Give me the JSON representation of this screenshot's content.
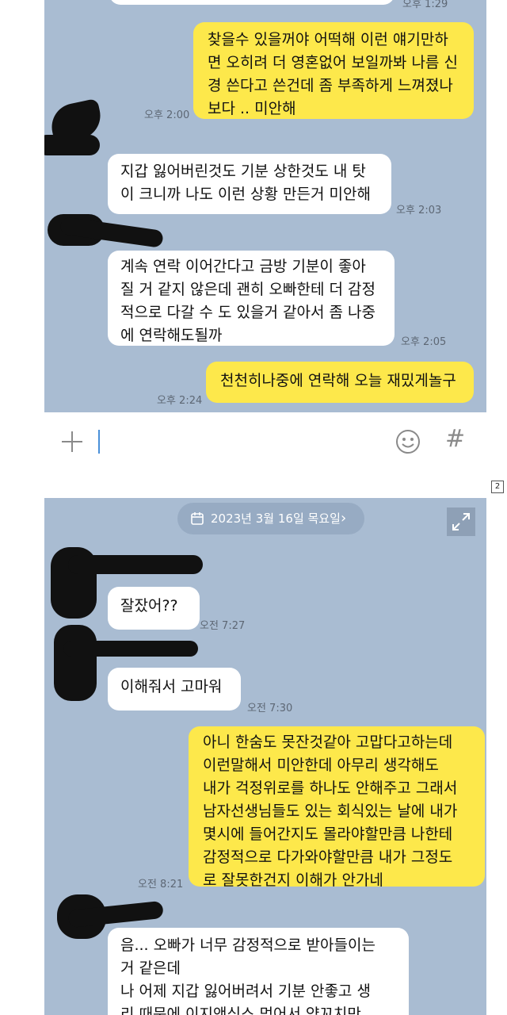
{
  "chat1": {
    "top_time": "오후 1:29",
    "messages": [
      {
        "side": "me",
        "text": "찾을수 있을꺼야 어떡해 이런 얘기만하\n면 오히려 더 영혼없어 보일까봐 나름 신\n경 쓴다고 쓴건데 좀 부족하게 느껴졌나\n보다 .. 미안해",
        "time": "오후 2:00"
      },
      {
        "side": "them",
        "text": "지갑 잃어버린것도 기분 상한것도 내 탓\n이 크니까 나도 이런 상황 만든거 미안해",
        "time": "오후 2:03"
      },
      {
        "side": "them",
        "text": "계속 연락 이어간다고 금방 기분이 좋아\n질 거 같지 않은데 괜히 오빠한테 더 감정\n적으로 다갈 수 도 있을거 같아서 좀 나중\n에 연락해도될까",
        "time": "오후 2:05"
      },
      {
        "side": "me",
        "text": "천천히나중에 연락해 오늘 재밌게놀구",
        "time": "오후 2:24"
      }
    ]
  },
  "input_bar": {
    "plus_icon": "plus-icon",
    "emoji_icon": "emoji-icon",
    "hash_symbol": "#"
  },
  "page_number": "2",
  "chat2": {
    "date_label": "2023년 3월 16일 목요일",
    "date_chevron": "›",
    "messages": [
      {
        "side": "them",
        "text": "잘잤어??",
        "time": "오전 7:27"
      },
      {
        "side": "them",
        "text": "이해줘서 고마워",
        "time": "오전 7:30"
      },
      {
        "side": "me",
        "text": "아니 한숨도 못잔것같아 고맙다고하는데\n이런말해서 미안한데 아무리 생각해도\n내가 걱정위로를 하나도 안해주고 그래서\n남자선생님들도 있는 회식있는 날에 내가\n몇시에 들어간지도 몰라야할만큼 나한테\n감정적으로 다가와야할만큼 내가 그정도\n로 잘못한건지 이해가 안가네",
        "time": "오전 8:21"
      },
      {
        "side": "them",
        "text": "음... 오빠가 너무 감정적으로 받아들이는\n거 같은데\n나 어제 지갑 잃어버려서 기분 안좋고 생\n리 때문에 이지앤식스 먹어서 양꼬치만",
        "time": ""
      }
    ]
  }
}
